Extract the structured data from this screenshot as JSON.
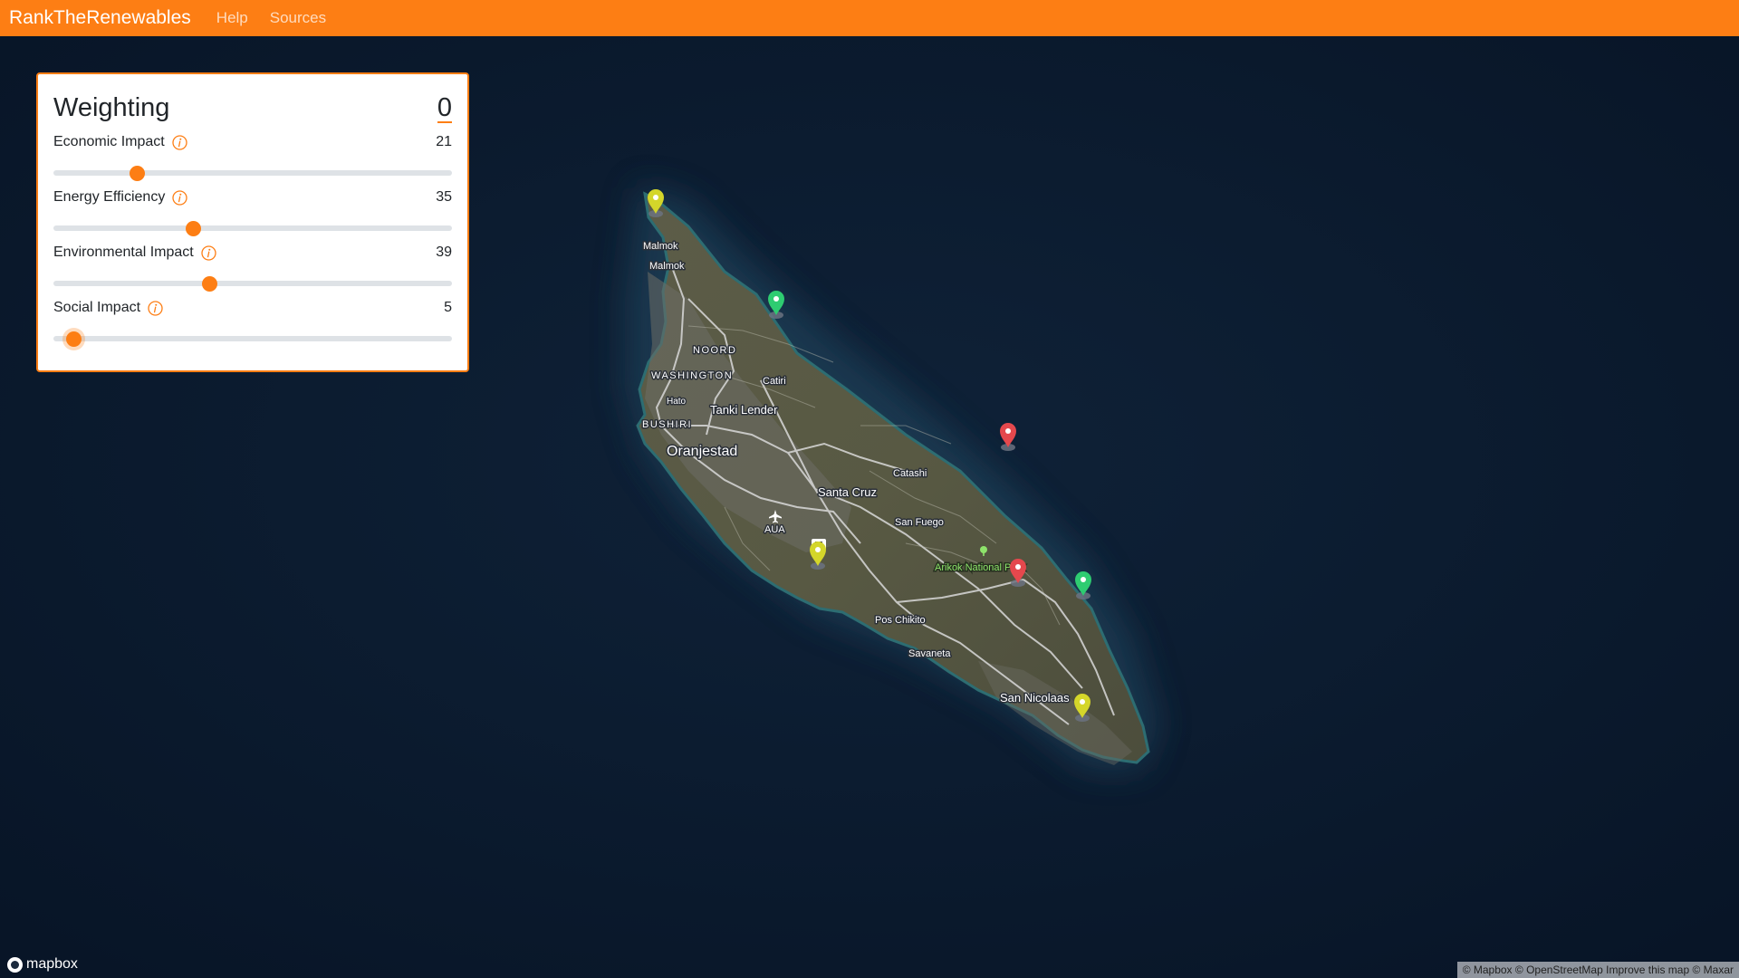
{
  "navbar": {
    "brand": "RankTheRenewables",
    "links": [
      "Help",
      "Sources"
    ]
  },
  "panel": {
    "title": "Weighting",
    "total": "0",
    "criteria": [
      {
        "label": "Economic Impact",
        "value": "21",
        "level": 21
      },
      {
        "label": "Energy Efficiency",
        "value": "35",
        "level": 35
      },
      {
        "label": "Environmental Impact",
        "value": "39",
        "level": 39
      },
      {
        "label": "Social Impact",
        "value": "5",
        "level": 5
      }
    ]
  },
  "map": {
    "labels": {
      "malmok_1": "Malmok",
      "malmok_2": "Malmok",
      "noord": "NOORD",
      "washington": "WASHINGTON",
      "catiri": "Catiri",
      "hato": "Hato",
      "tanki_lender": "Tanki Lender",
      "bushiri": "BUSHIRI",
      "oranjestad": "Oranjestad",
      "catashi": "Catashi",
      "santa_cruz": "Santa Cruz",
      "san_fuego": "San Fuego",
      "aua": "AUA",
      "arikok": "Arikok National Park",
      "pos_chikito": "Pos Chikito",
      "savaneta": "Savaneta",
      "san_nicolaas": "San Nicolaas"
    },
    "marker_colors": {
      "green": "#2ecc71",
      "yellow": "#d4d62a",
      "red": "#e5484d"
    },
    "logo_text": "mapbox",
    "attribution": "© Mapbox © OpenStreetMap Improve this map © Maxar"
  },
  "colors": {
    "accent": "#fd7e14",
    "water": "#0b1a30",
    "land": "#55553f"
  }
}
